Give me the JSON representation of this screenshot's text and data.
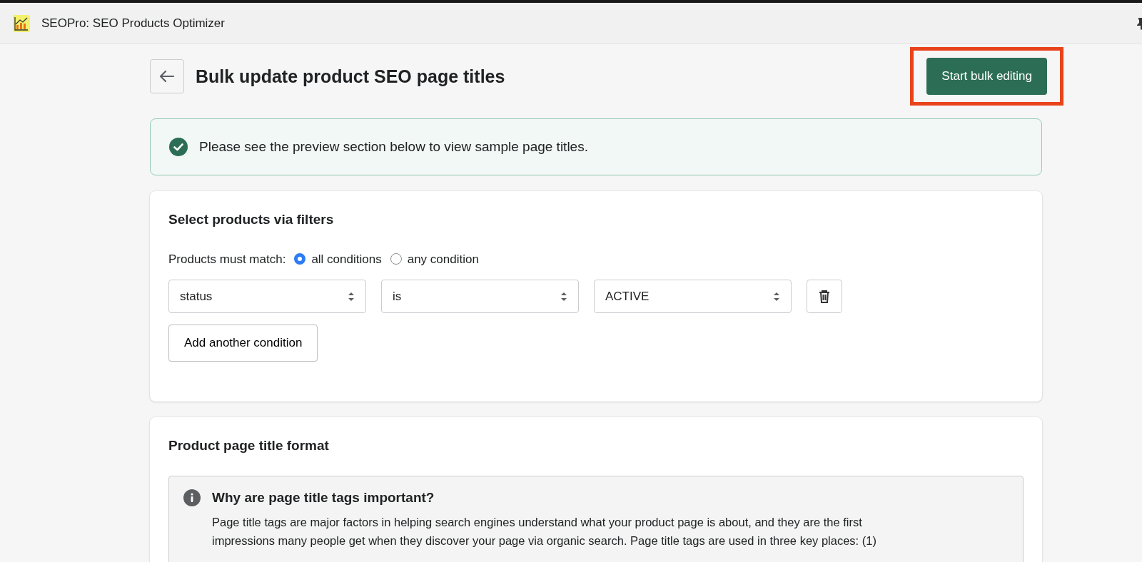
{
  "app_bar": {
    "title": "SEOPro: SEO Products Optimizer"
  },
  "page": {
    "title": "Bulk update product SEO page titles",
    "primary_action": {
      "label": "Start bulk editing",
      "highlighted": true
    }
  },
  "banner": {
    "kind": "success",
    "message": "Please see the preview section below to view sample page titles."
  },
  "filters": {
    "title": "Select products via filters",
    "match_label": "Products must match:",
    "match_options": [
      {
        "label": "all conditions",
        "selected": true
      },
      {
        "label": "any condition",
        "selected": false
      }
    ],
    "conditions": [
      {
        "field": "status",
        "operator": "is",
        "value": "ACTIVE"
      }
    ],
    "add_button": "Add another condition"
  },
  "title_format": {
    "title": "Product page title format",
    "info": {
      "heading": "Why are page title tags important?",
      "lines": [
        "Page title tags are major factors in helping search engines understand what your product page is about, and they are the first",
        "impressions many people get when they discover your page via organic search. Page title tags are used in three key places: (1)"
      ]
    }
  }
}
